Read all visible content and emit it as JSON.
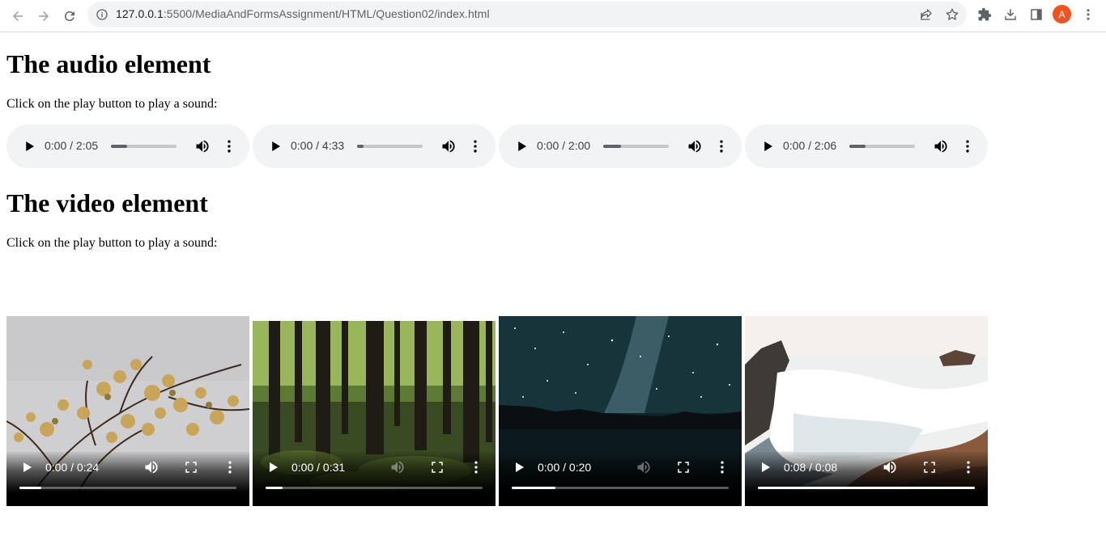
{
  "browser": {
    "url_host": "127.0.0.1",
    "url_rest": ":5500/MediaAndFormsAssignment/HTML/Question02/index.html",
    "profile_initial": "A",
    "colors": {
      "omnibox": "#f1f3f4",
      "avatar": "#f4511e"
    },
    "icons": [
      "back-arrow-icon",
      "forward-arrow-icon",
      "reload-icon",
      "info-icon",
      "share-icon",
      "star-icon",
      "extensions-icon",
      "download-icon",
      "side-panel-icon",
      "menu-dots-icon"
    ]
  },
  "audio_section": {
    "heading": "The audio element",
    "text": "Click on the play button to play a sound:",
    "players": [
      {
        "time": "0:00 / 2:05",
        "volume_level": 0.25
      },
      {
        "time": "0:00 / 4:33",
        "volume_level": 0.1
      },
      {
        "time": "0:00 / 2:00",
        "volume_level": 0.27
      },
      {
        "time": "0:00 / 2:06",
        "volume_level": 0.25
      }
    ]
  },
  "video_section": {
    "heading": "The video element",
    "text": "Click on the play button to play a sound:",
    "players": [
      {
        "time": "0:00 / 0:24",
        "progress": 0.1,
        "muted_style": false,
        "scene": "flowering tree branches"
      },
      {
        "time": "0:00 / 0:31",
        "progress": 0.08,
        "muted_style": true,
        "scene": "forest"
      },
      {
        "time": "0:00 / 0:20",
        "progress": 0.2,
        "muted_style": true,
        "scene": "milky way night sky"
      },
      {
        "time": "0:08 / 0:08",
        "progress": 1.0,
        "muted_style": false,
        "scene": "ocean waves on rocks"
      }
    ]
  }
}
